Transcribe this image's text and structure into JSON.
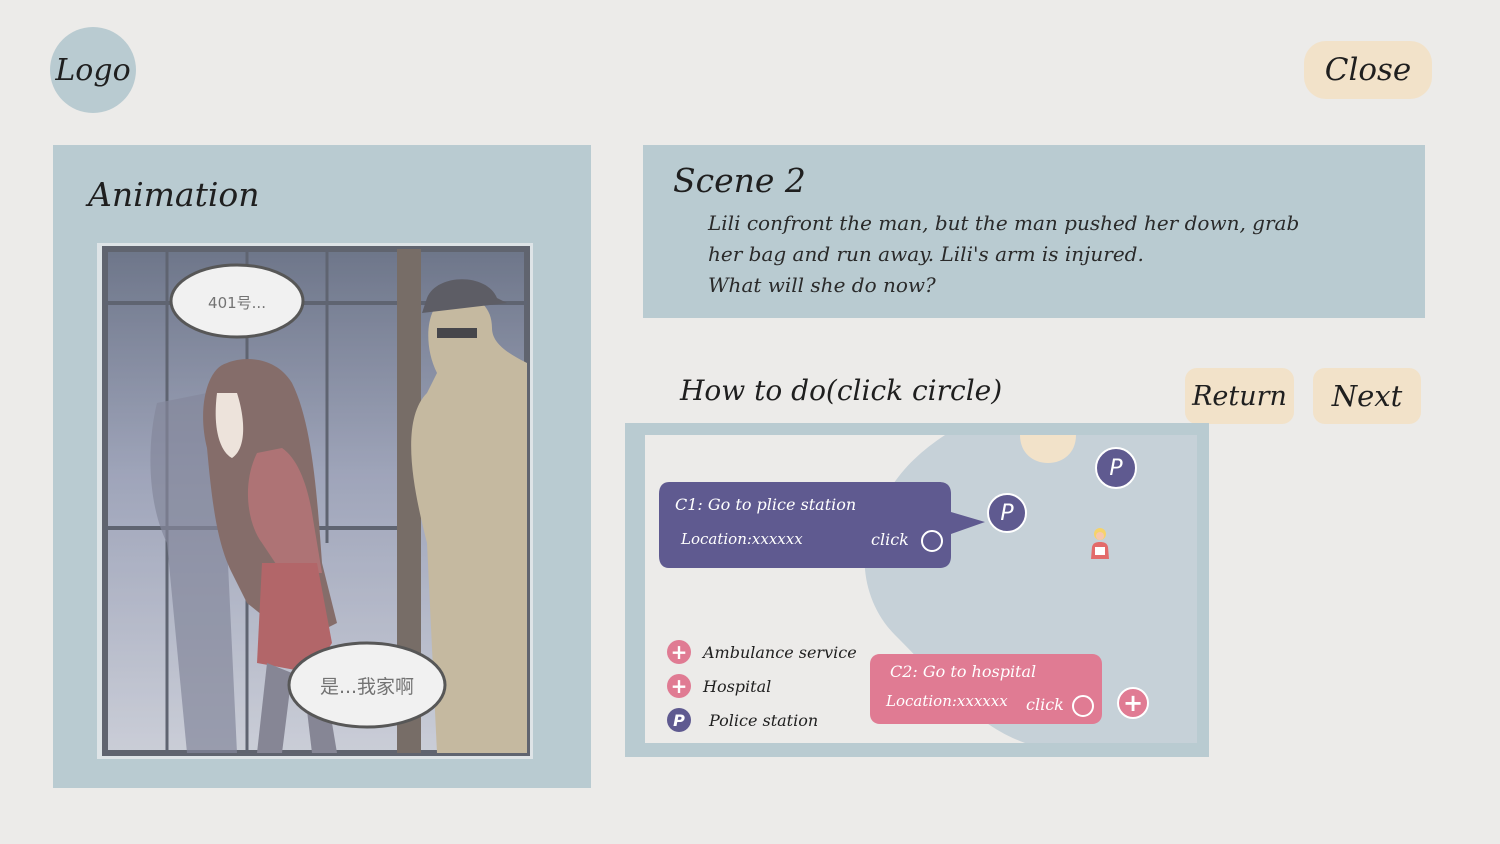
{
  "header": {
    "logo_label": "Logo",
    "close_label": "Close"
  },
  "animation": {
    "title": "Animation",
    "bubble_top": "401号...",
    "bubble_bottom": "是...我家啊"
  },
  "scene": {
    "title": "Scene 2",
    "line1": "Lili confront the man, but the man pushed her down, grab",
    "line2": "her bag and run away. Lili's arm is injured.",
    "line3": "What will she do now?"
  },
  "howto": {
    "title": "How to do(click circle)",
    "return_label": "Return",
    "next_label": "Next"
  },
  "map": {
    "choice1": {
      "title": "C1: Go to plice station",
      "location": "Location:xxxxxx",
      "click": "click"
    },
    "choice2": {
      "title": "C2: Go to hospital",
      "location": "Location:xxxxxx",
      "click": "click"
    },
    "pin_p_label": "P",
    "legend": [
      {
        "icon": "+",
        "label": "Ambulance service"
      },
      {
        "icon": "+",
        "label": "Hospital"
      },
      {
        "icon": "P",
        "label": "Police station"
      }
    ],
    "colors": {
      "police": "#5f5a90",
      "hospital": "#e07b93",
      "map_land": "#c6d1d8",
      "sun": "#f2e2c9"
    }
  }
}
